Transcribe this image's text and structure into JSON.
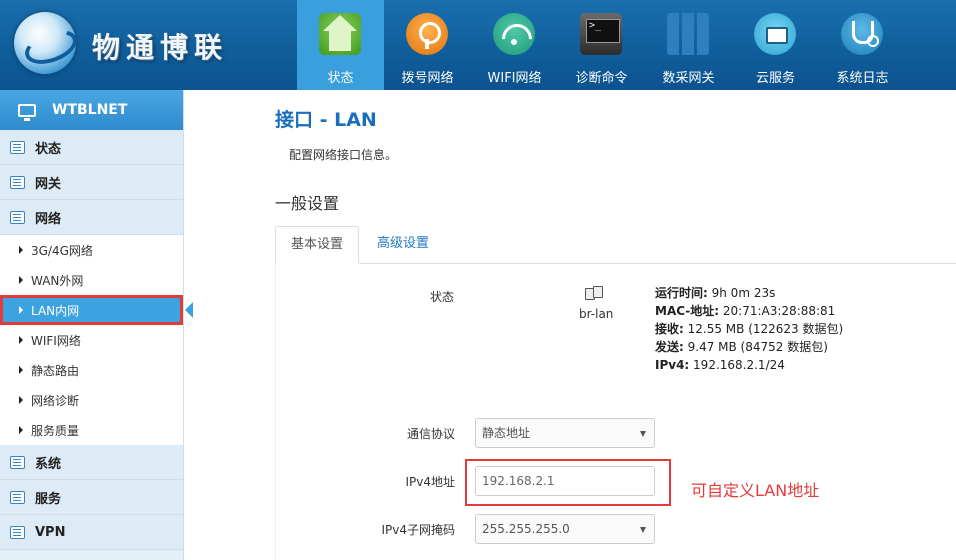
{
  "brand": {
    "name": "物通博联"
  },
  "nav": [
    {
      "label": "状态",
      "icon": "home-icon",
      "active": true
    },
    {
      "label": "拨号网络",
      "icon": "dial-network-icon"
    },
    {
      "label": "WIFI网络",
      "icon": "wifi-icon"
    },
    {
      "label": "诊断命令",
      "icon": "terminal-icon"
    },
    {
      "label": "数采网关",
      "icon": "gateway-icon"
    },
    {
      "label": "云服务",
      "icon": "cloud-icon"
    },
    {
      "label": "系统日志",
      "icon": "stethoscope-icon"
    }
  ],
  "sidebar": {
    "title": "WTBLNET",
    "groups": {
      "status": "状态",
      "gateway": "网关",
      "network": "网络",
      "system": "系统",
      "service": "服务",
      "vpn": "VPN"
    },
    "network_items": [
      "3G/4G网络",
      "WAN外网",
      "LAN内网",
      "WIFI网络",
      "静态路由",
      "网络诊断",
      "服务质量"
    ],
    "active_item": "LAN内网"
  },
  "main": {
    "title": "接口 - LAN",
    "description": "配置网络接口信息。",
    "section_title": "一般设置",
    "tabs": {
      "basic": "基本设置",
      "advanced": "高级设置"
    },
    "status": {
      "label": "状态",
      "interface": "br-lan",
      "uptime_label": "运行时间:",
      "uptime_value": " 9h 0m 23s",
      "mac_label": "MAC-地址:",
      "mac_value": " 20:71:A3:28:88:81",
      "rx_label": "接收:",
      "rx_value": " 12.55 MB (122623 数据包)",
      "tx_label": "发送:",
      "tx_value": " 9.47 MB (84752 数据包)",
      "ipv4_label": "IPv4:",
      "ipv4_value": " 192.168.2.1/24"
    },
    "form": {
      "protocol_label": "通信协议",
      "protocol_value": "静态地址",
      "ipv4_label": "IPv4地址",
      "ipv4_value": "192.168.2.1",
      "netmask_label": "IPv4子网掩码",
      "netmask_value": "255.255.255.0"
    },
    "annotation": "可自定义LAN地址"
  },
  "colors": {
    "header": "#0f5d9a",
    "accent": "#3aa0dd",
    "link": "#1f7ac7",
    "highlight": "#e33a3a"
  }
}
